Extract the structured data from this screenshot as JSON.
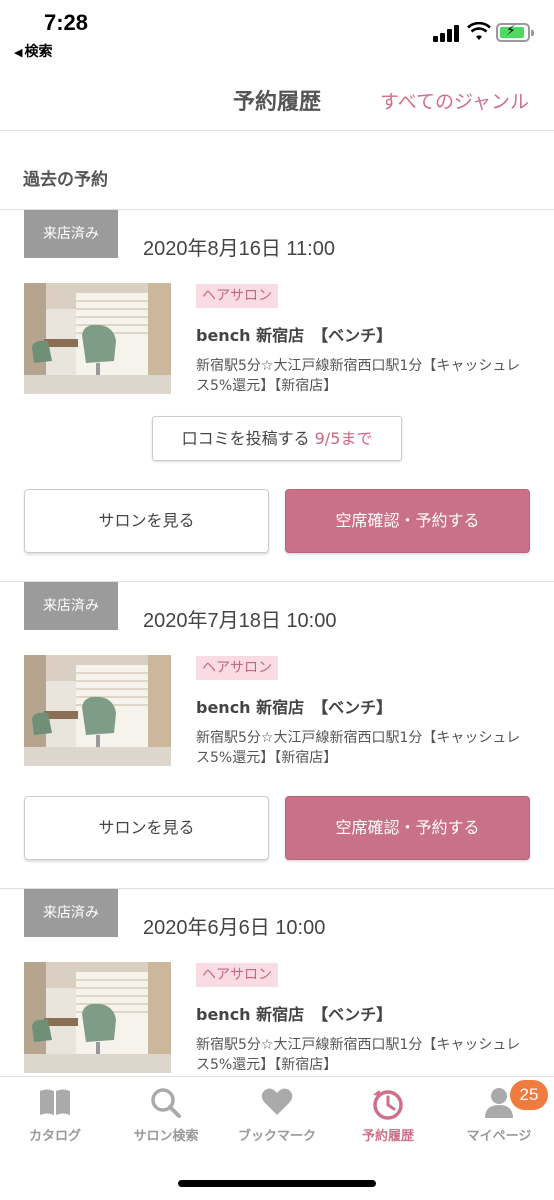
{
  "status": {
    "time": "7:28",
    "back_label": "検索"
  },
  "header": {
    "title": "予約履歴",
    "genre_link": "すべてのジャンル"
  },
  "section_title": "過去の予約",
  "reservations": [
    {
      "status_badge": "来店済み",
      "date": "2020年8月16日 11:00",
      "genre": "ヘアサロン",
      "salon_name": "bench 新宿店　【ベンチ】",
      "description": "新宿駅5分☆大江戸線新宿西口駅1分【キャッシュレス5%還元】【新宿店】",
      "review_label": "口コミを投稿する",
      "review_deadline": "9/5まで",
      "view_label": "サロンを見る",
      "reserve_label": "空席確認・予約する"
    },
    {
      "status_badge": "来店済み",
      "date": "2020年7月18日 10:00",
      "genre": "ヘアサロン",
      "salon_name": "bench 新宿店　【ベンチ】",
      "description": "新宿駅5分☆大江戸線新宿西口駅1分【キャッシュレス5%還元】【新宿店】",
      "view_label": "サロンを見る",
      "reserve_label": "空席確認・予約する"
    },
    {
      "status_badge": "来店済み",
      "date": "2020年6月6日 10:00",
      "genre": "ヘアサロン",
      "salon_name": "bench 新宿店　【ベンチ】",
      "description": "新宿駅5分☆大江戸線新宿西口駅1分【キャッシュレス5%還元】【新宿店】"
    }
  ],
  "tabs": [
    {
      "label": "カタログ",
      "icon": "book-icon"
    },
    {
      "label": "サロン検索",
      "icon": "search-icon"
    },
    {
      "label": "ブックマーク",
      "icon": "heart-icon"
    },
    {
      "label": "予約履歴",
      "icon": "clock-icon",
      "active": true
    },
    {
      "label": "マイページ",
      "icon": "person-icon"
    }
  ],
  "notification_count": "25",
  "colors": {
    "accent": "#d06f8a",
    "reserve_button": "#c97186",
    "badge": "#9b9b9b",
    "notif": "#ef7b3e"
  }
}
